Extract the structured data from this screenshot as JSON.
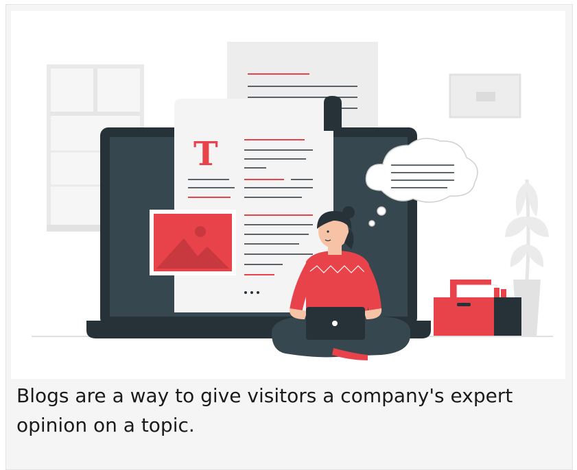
{
  "illustration": {
    "icon": "blogging-illustration-icon",
    "letter": "T",
    "colors": {
      "accent": "#e8424a",
      "dark": "#263238",
      "light_gray": "#ebebeb",
      "mid_gray": "#d9d9d9"
    }
  },
  "caption": {
    "text": "Blogs are a way to give visitors a company's expert opinion on a topic."
  }
}
